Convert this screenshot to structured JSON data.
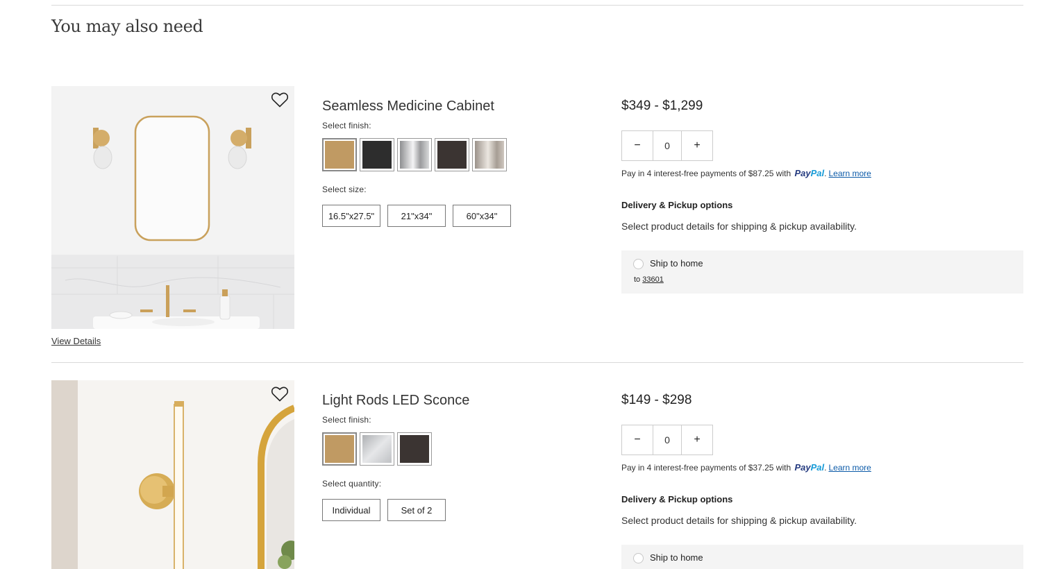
{
  "section": {
    "title": "You may also need"
  },
  "products": [
    {
      "name": "Seamless Medicine Cabinet",
      "finish_label": "Select finish:",
      "finishes": [
        {
          "name": "brass",
          "color": "#c09a63",
          "selected": true
        },
        {
          "name": "black",
          "color": "#2d2d2d"
        },
        {
          "name": "chrome",
          "color": "#b9babb"
        },
        {
          "name": "dark-bronze",
          "color": "#3b3432"
        },
        {
          "name": "nickel",
          "color": "#b8afa4"
        }
      ],
      "option_label": "Select size:",
      "options": [
        "16.5\"x27.5\"",
        "21\"x34\"",
        "60\"x34\""
      ],
      "price": "$349 - $1,299",
      "quantity": "0",
      "paypal_text": "Pay in 4 interest-free payments of $87.25 with",
      "paypal_brand_1": "Pay",
      "paypal_brand_2": "Pal",
      "learn_more": "Learn more",
      "delivery_title": "Delivery & Pickup options",
      "delivery_sub": "Select product details for shipping & pickup availability.",
      "ship_label": "Ship to home",
      "ship_to_prefix": "to",
      "zip": "33601",
      "view_details": "View Details"
    },
    {
      "name": "Light Rods LED Sconce",
      "finish_label": "Select finish:",
      "finishes": [
        {
          "name": "brass",
          "color": "#c09a63",
          "selected": true
        },
        {
          "name": "chrome",
          "color": "#c4c6c9"
        },
        {
          "name": "dark-bronze",
          "color": "#3b3432"
        }
      ],
      "option_label": "Select quantity:",
      "options": [
        "Individual",
        "Set of 2"
      ],
      "price": "$149 - $298",
      "quantity": "0",
      "paypal_text": "Pay in 4 interest-free payments of $37.25 with",
      "paypal_brand_1": "Pay",
      "paypal_brand_2": "Pal",
      "learn_more": "Learn more",
      "delivery_title": "Delivery & Pickup options",
      "delivery_sub": "Select product details for shipping & pickup availability.",
      "ship_label": "Ship to home"
    }
  ],
  "icons": {
    "wishlist": "heart-icon",
    "minus": "minus-icon",
    "plus": "plus-icon"
  },
  "glyphs": {
    "minus": "−",
    "plus": "+"
  }
}
